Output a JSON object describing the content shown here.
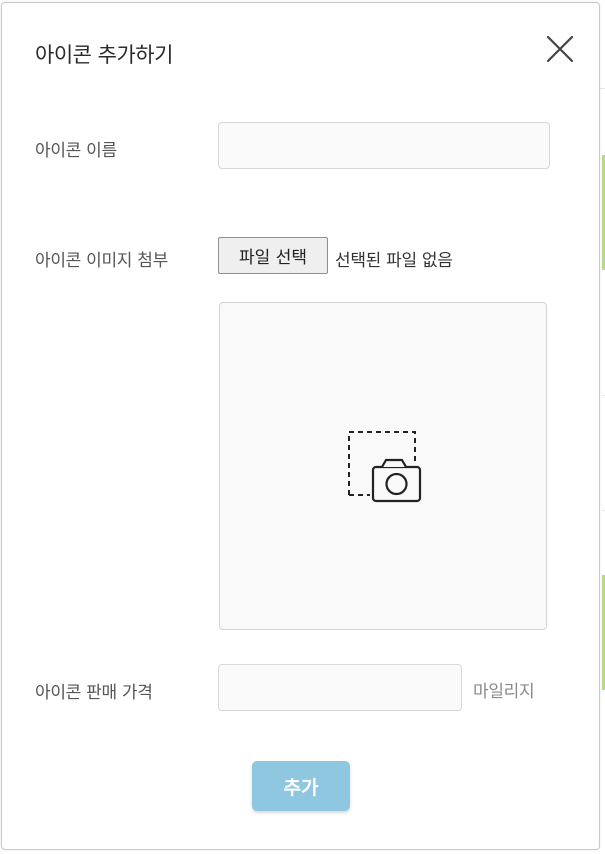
{
  "modal": {
    "title": "아이콘 추가하기",
    "close_icon": "close-icon"
  },
  "form": {
    "name_label": "아이콘 이름",
    "name_value": "",
    "image_label": "아이콘 이미지 첨부",
    "file_button_label": "파일 선택",
    "file_status": "선택된 파일 없음",
    "preview_icon": "camera-icon",
    "price_label": "아이콘 판매 가격",
    "price_value": "",
    "price_unit": "마일리지",
    "submit_label": "추가"
  },
  "colors": {
    "submit_bg": "#8fc6e0",
    "preview_bg": "#f9f9f9"
  }
}
